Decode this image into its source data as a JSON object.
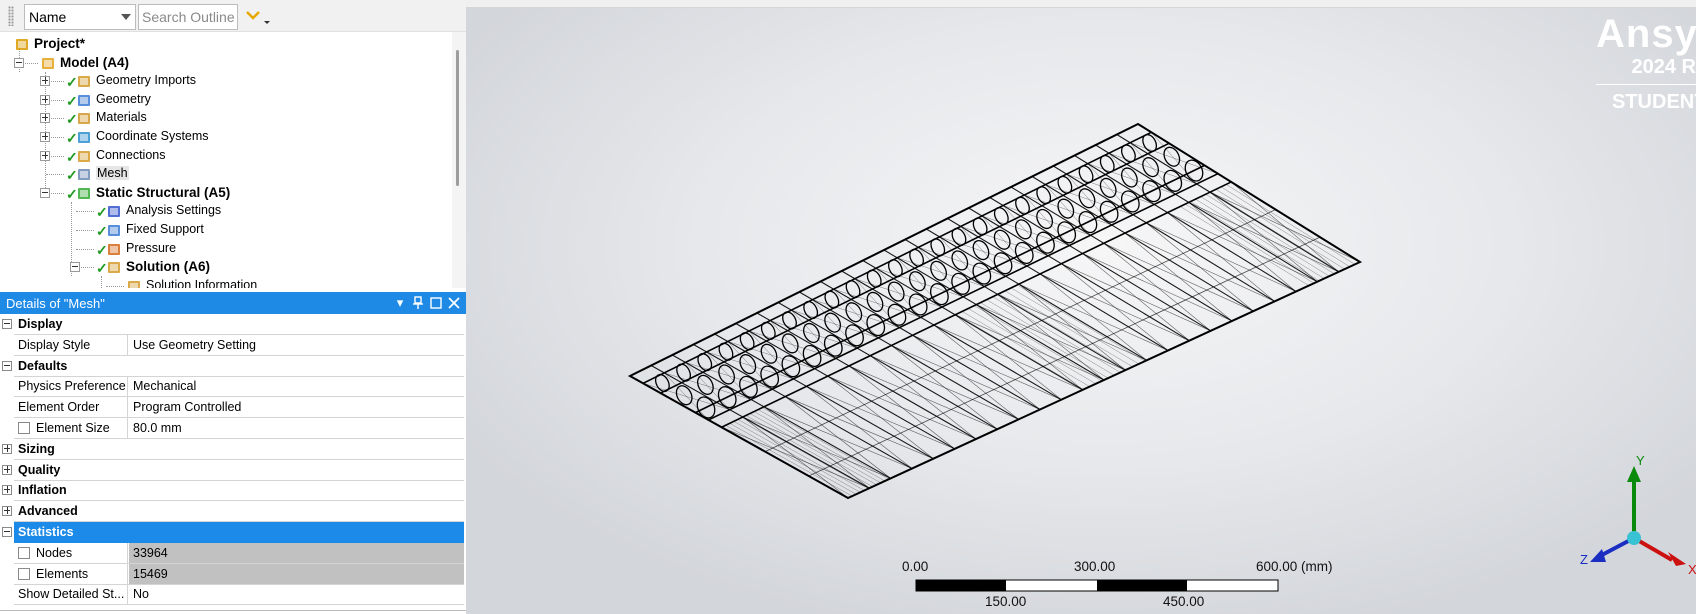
{
  "outline": {
    "filter_value": "Name",
    "search_placeholder": "Search Outline",
    "tree": [
      {
        "label": "Project*",
        "level": 0,
        "bold": true,
        "toggle": "none",
        "icon": "project-icon",
        "status": "none"
      },
      {
        "label": "Model (A4)",
        "level": 1,
        "bold": true,
        "toggle": "minus",
        "icon": "model-icon",
        "status": "none"
      },
      {
        "label": "Geometry Imports",
        "level": 2,
        "bold": false,
        "toggle": "plus",
        "icon": "geometry-imports-icon",
        "status": "check"
      },
      {
        "label": "Geometry",
        "level": 2,
        "bold": false,
        "toggle": "plus",
        "icon": "geometry-icon",
        "status": "check"
      },
      {
        "label": "Materials",
        "level": 2,
        "bold": false,
        "toggle": "plus",
        "icon": "materials-icon",
        "status": "check"
      },
      {
        "label": "Coordinate Systems",
        "level": 2,
        "bold": false,
        "toggle": "plus",
        "icon": "coordinate-systems-icon",
        "status": "check"
      },
      {
        "label": "Connections",
        "level": 2,
        "bold": false,
        "toggle": "plus",
        "icon": "connections-icon",
        "status": "check"
      },
      {
        "label": "Mesh",
        "level": 2,
        "bold": false,
        "toggle": "none",
        "icon": "mesh-icon",
        "status": "check",
        "selected": true
      },
      {
        "label": "Static Structural (A5)",
        "level": 2,
        "bold": true,
        "toggle": "minus",
        "icon": "static-structural-icon",
        "status": "check"
      },
      {
        "label": "Analysis Settings",
        "level": 3,
        "bold": false,
        "toggle": "none",
        "icon": "analysis-settings-icon",
        "status": "check"
      },
      {
        "label": "Fixed Support",
        "level": 3,
        "bold": false,
        "toggle": "none",
        "icon": "fixed-support-icon",
        "status": "check"
      },
      {
        "label": "Pressure",
        "level": 3,
        "bold": false,
        "toggle": "none",
        "icon": "pressure-icon",
        "status": "check"
      },
      {
        "label": "Solution (A6)",
        "level": 3,
        "bold": true,
        "toggle": "minus",
        "icon": "solution-icon",
        "status": "check"
      },
      {
        "label": "Solution Information",
        "level": 4,
        "bold": false,
        "toggle": "none",
        "icon": "solution-information-icon",
        "status": "none"
      }
    ]
  },
  "details": {
    "title": "Details of \"Mesh\"",
    "rows": [
      {
        "kind": "section",
        "label": "Display",
        "state": "expanded"
      },
      {
        "kind": "prop",
        "key": "Display Style",
        "value": "Use Geometry Setting"
      },
      {
        "kind": "section",
        "label": "Defaults",
        "state": "expanded"
      },
      {
        "kind": "prop",
        "key": "Physics Preference",
        "value": "Mechanical"
      },
      {
        "kind": "prop",
        "key": "Element Order",
        "value": "Program Controlled"
      },
      {
        "kind": "prop",
        "key": "Element Size",
        "value": "80.0 mm",
        "checkbox": true
      },
      {
        "kind": "section",
        "label": "Sizing",
        "state": "collapsed"
      },
      {
        "kind": "section",
        "label": "Quality",
        "state": "collapsed"
      },
      {
        "kind": "section",
        "label": "Inflation",
        "state": "collapsed"
      },
      {
        "kind": "section",
        "label": "Advanced",
        "state": "collapsed"
      },
      {
        "kind": "section",
        "label": "Statistics",
        "state": "expanded",
        "selected": true
      },
      {
        "kind": "prop",
        "key": "Nodes",
        "value": "33964",
        "checkbox": true,
        "stat": true
      },
      {
        "kind": "prop",
        "key": "Elements",
        "value": "15469",
        "checkbox": true,
        "stat": true
      },
      {
        "kind": "prop",
        "key": "Show Detailed St...",
        "value": "No"
      }
    ]
  },
  "viewport": {
    "logo_name": "Ansys",
    "logo_year": "2024 R",
    "logo_edition": "STUDENT",
    "scale_bar": {
      "top_labels": [
        "0.00",
        "300.00",
        "600.00 (mm)"
      ],
      "bottom_labels": [
        "150.00",
        "450.00"
      ]
    },
    "triad": {
      "x": "X",
      "y": "Y",
      "z": "Z"
    }
  },
  "colors": {
    "accent": "#1e8ae6",
    "check": "#1f9a1f",
    "stat_cell": "#c1c1c1"
  }
}
